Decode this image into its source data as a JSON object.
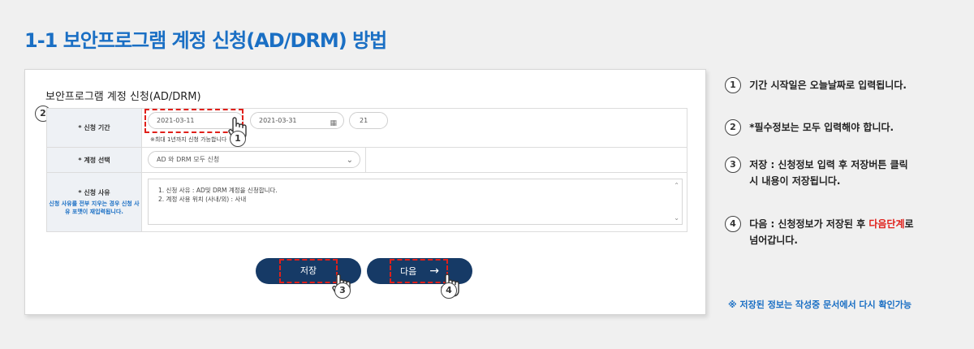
{
  "page_title": "1-1 보안프로그램 계정 신청(AD/DRM) 방법",
  "form": {
    "title": "보안프로그램 계정 신청(AD/DRM)",
    "rows": {
      "period_label": "* 신청 기간",
      "start_date": "2021-03-11",
      "end_date": "2021-03-31",
      "days": "21",
      "period_note": "※최대 1년까지 신청 가능합니다",
      "account_label": "* 계정 선택",
      "account_value": "AD 와 DRM 모두 신청",
      "reason_label": "* 신청 사유",
      "reason_note": "신청 사유를 전부 지우는 경우 신청 사유 포맷이 재입력됩니다.",
      "reason_line1": "1. 신청 사유 : AD및 DRM 계정을 신청합니다.",
      "reason_line2": "2. 계정 사용 위치 (사내/외) : 사내"
    },
    "save_label": "저장",
    "next_label": "다음",
    "next_arrow": "→"
  },
  "markers": {
    "m1": "1",
    "m2": "2",
    "m3": "3",
    "m4": "4"
  },
  "steps": [
    {
      "num": "1",
      "text": "기간 시작일은 오늘날짜로 입력됩니다."
    },
    {
      "num": "2",
      "text": "*필수정보는 모두 입력해야 합니다."
    },
    {
      "num": "3",
      "line1": "저장 : 신청정보 입력 후 저장버튼 클릭",
      "line2": "시 내용이 저장됩니다."
    },
    {
      "num": "4",
      "pre": "다음 : 신청정보가 저장된 후 ",
      "red": "다음단계",
      "post": "로",
      "line2": "넘어갑니다."
    }
  ],
  "footer_note": "※ 저장된 정보는 작성중 문서에서 다시 확인가능",
  "colors": {
    "title_blue": "#1a6fc4",
    "button_navy": "#163a66",
    "highlight_red": "#e0201a"
  },
  "icons": [
    "calendar-icon",
    "chevron-down-icon",
    "pointer-hand-icon",
    "arrow-right-icon"
  ]
}
